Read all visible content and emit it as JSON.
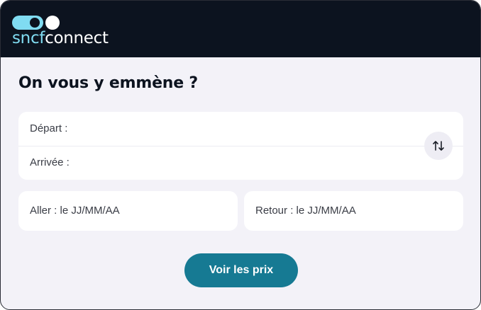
{
  "header": {
    "logo_prefix": "sncf",
    "logo_suffix": "connect"
  },
  "search": {
    "title": "On vous y emmène ?",
    "departure_label": "Départ :",
    "arrival_label": "Arrivée :",
    "swap_icon": "swap-vertical-icon",
    "outbound_label": "Aller : le JJ/MM/AA",
    "return_label": "Retour : le JJ/MM/AA",
    "submit_label": "Voir les prix"
  },
  "colors": {
    "header_bg": "#0c131f",
    "logo_accent": "#80dcf2",
    "page_bg": "#f3f2f8",
    "cta_bg": "#167a93"
  }
}
